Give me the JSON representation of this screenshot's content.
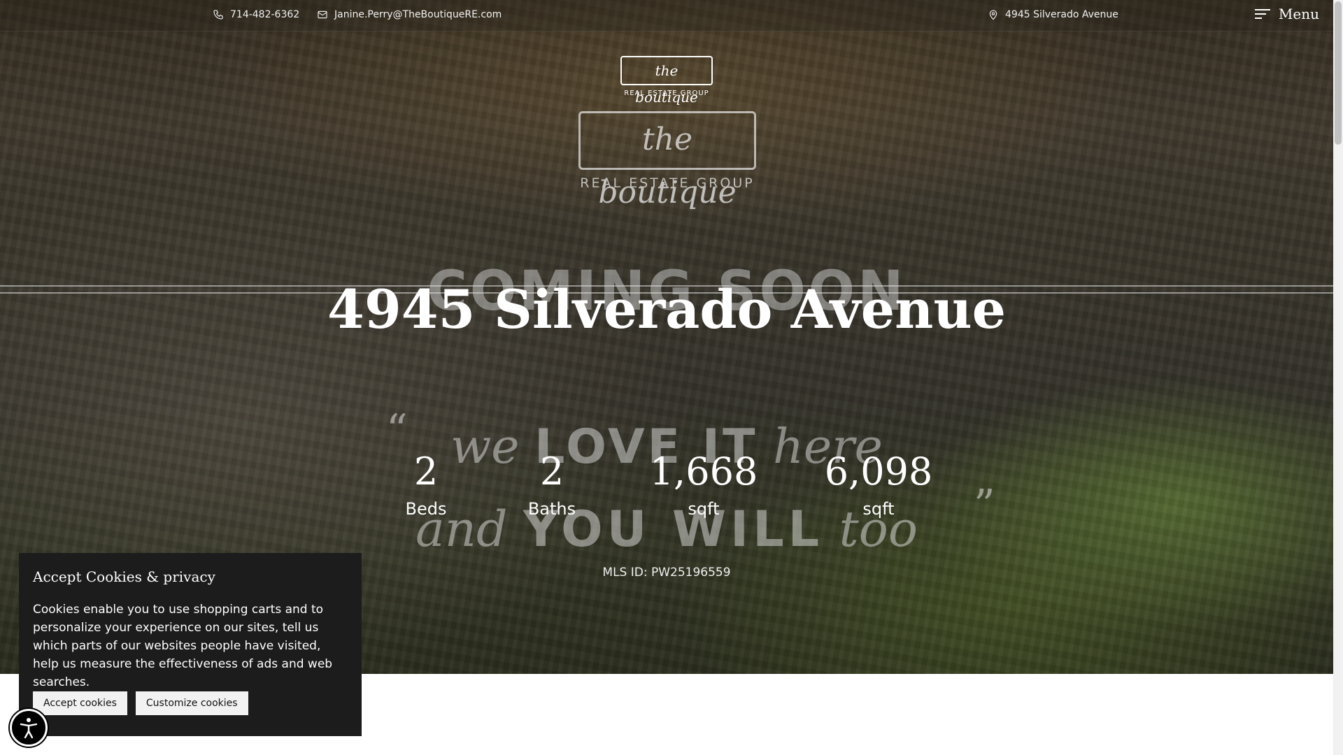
{
  "topbar": {
    "phone": "714-482-6362",
    "email": "Janine.Perry@TheBoutiqueRE.com",
    "address": "4945 Silverado Avenue",
    "menu_label": "Menu"
  },
  "logo_small": {
    "name": "the boutique",
    "sub": "REAL ESTATE GROUP"
  },
  "logo_large": {
    "name": "the boutique",
    "sub": "REAL ESTATE GROUP"
  },
  "overlay": {
    "coming_soon": "COMING SOON",
    "tagline_we": "we",
    "tagline_love": "LOVE IT",
    "tagline_here": "here",
    "tagline_and": "and",
    "tagline_you_will": "YOU WILL",
    "tagline_too": "too",
    "quote_open": "“",
    "quote_close": "”"
  },
  "listing": {
    "title": "4945 Silverado Avenue",
    "stats": [
      {
        "value": "2",
        "label": "Beds"
      },
      {
        "value": "2",
        "label": "Baths"
      },
      {
        "value": "1,668",
        "label": "sqft"
      },
      {
        "value": "6,098",
        "label": "sqft"
      }
    ],
    "mls": "MLS ID: PW25196559"
  },
  "cookie": {
    "title": "Accept Cookies & privacy",
    "text": "Cookies enable you to use shopping carts and to personalize your experience on our sites, tell us which parts of our websites people have visited, help us measure the effectiveness of ads and web searches.",
    "accept_label": "Accept cookies",
    "customize_label": "Customize cookies"
  },
  "icons": {
    "phone": "phone-icon",
    "email": "mail-icon",
    "address": "map-pin-icon",
    "menu": "hamburger-menu-icon",
    "accessibility": "accessibility-icon"
  }
}
